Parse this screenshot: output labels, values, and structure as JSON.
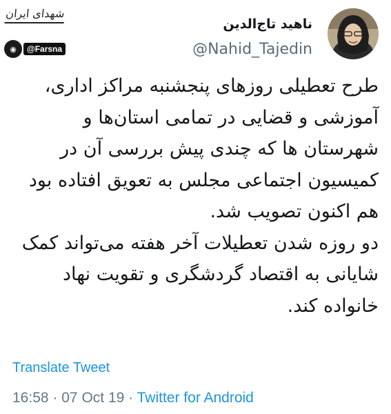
{
  "watermark": {
    "text": "شهدای ایران"
  },
  "profile": {
    "display_name": "ناهید تاج‌الدین",
    "handle": "@Nahid_Tajedin",
    "badge_text": "@Farsna"
  },
  "tweet": {
    "paragraph_1": "طرح تعطیلی روزهای پنجشنبه مراکز اداری، آموزشی و قضایی در تمامی استان‌ها و شهرستان ها که چندی پیش بررسی آن در کمیسیون اجتماعی مجلس به تعویق افتاده بود هم اکنون تصویب شد.",
    "paragraph_2": "دو روزه شدن تعطیلات آخر هفته می‌تواند کمک شایانی به اقتصاد گردشگری و تقویت نهاد خانواده کند."
  },
  "translate_label": "Translate Tweet",
  "meta": {
    "time": "16:58",
    "date": "07 Oct 19",
    "separator": "·",
    "source": "Twitter for Android"
  }
}
